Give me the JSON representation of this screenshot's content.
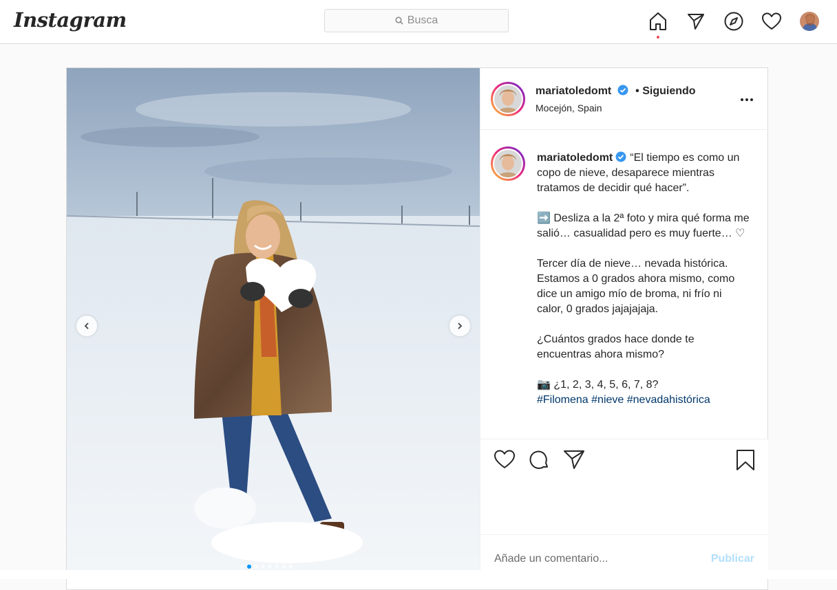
{
  "app": {
    "logo": "Instagram"
  },
  "search": {
    "placeholder": "Busca",
    "icon": "search-icon"
  },
  "nav": {
    "icons": [
      "home-icon",
      "direct-icon",
      "explore-icon",
      "activity-heart-icon",
      "profile-avatar"
    ],
    "active": "home-icon"
  },
  "post": {
    "username": "mariatoledomt",
    "verified": true,
    "follow_status": "• Siguiendo",
    "location": "Mocejón, Spain",
    "caption": {
      "line1": "“El tiempo es como un copo de nieve, desaparece mientras tratamos de decidir qué hacer”.",
      "line2": "➡️ Desliza a la 2ª foto y mira qué forma me salió… casualidad pero es muy fuerte… ♡",
      "line3": "Tercer día de nieve… nevada histórica. Estamos a 0 grados ahora mismo, como dice un amigo mío de broma, ni frío ni calor, 0 grados jajajajaja.",
      "line4": "¿Cuántos grados hace donde te encuentras ahora mismo?",
      "line5": "📷 ¿1, 2, 3, 4, 5, 6, 7, 8?",
      "hashtags": "#Filomena #nieve #nevadahistórica"
    },
    "carousel": {
      "current": 2,
      "total": 8
    }
  },
  "comment": {
    "placeholder": "Añade un comentario...",
    "publish_label": "Publicar"
  },
  "colors": {
    "accent": "#0095f6",
    "publish_disabled": "#b2dffc",
    "hashtag": "#00376b",
    "verified": "#3897f0"
  }
}
